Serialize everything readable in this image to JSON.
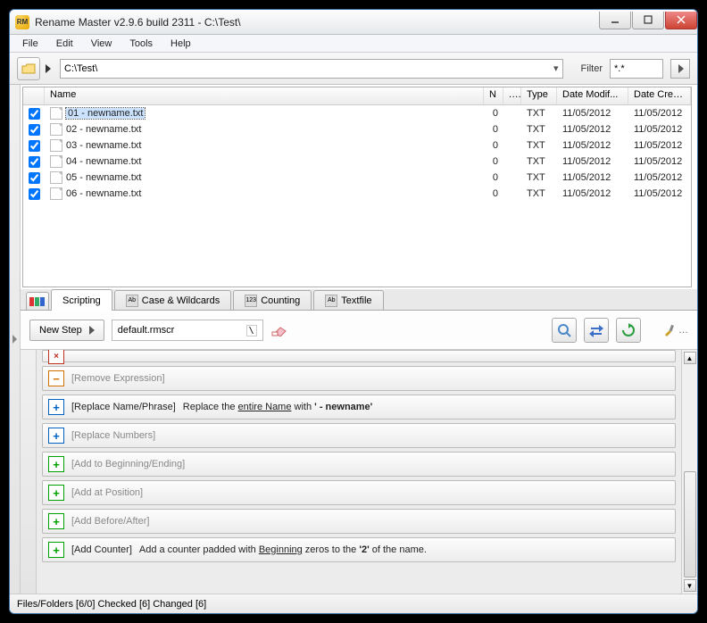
{
  "title": "Rename Master v2.9.6 build 2311 - C:\\Test\\",
  "menu": {
    "file": "File",
    "edit": "Edit",
    "view": "View",
    "tools": "Tools",
    "help": "Help"
  },
  "path": "C:\\Test\\",
  "filter_label": "Filter",
  "filter_value": "*.*",
  "columns": {
    "name": "Name",
    "n": "N",
    "dots": "...",
    "type": "Type",
    "date_modified": "Date Modif...",
    "date_created": "Date Crea..."
  },
  "files": [
    {
      "checked": true,
      "name": "01 - newname.txt",
      "n": "0",
      "type": "TXT",
      "dm": "11/05/2012",
      "dc": "11/05/2012",
      "selected": true
    },
    {
      "checked": true,
      "name": "02 - newname.txt",
      "n": "0",
      "type": "TXT",
      "dm": "11/05/2012",
      "dc": "11/05/2012",
      "selected": false
    },
    {
      "checked": true,
      "name": "03 - newname.txt",
      "n": "0",
      "type": "TXT",
      "dm": "11/05/2012",
      "dc": "11/05/2012",
      "selected": false
    },
    {
      "checked": true,
      "name": "04 - newname.txt",
      "n": "0",
      "type": "TXT",
      "dm": "11/05/2012",
      "dc": "11/05/2012",
      "selected": false
    },
    {
      "checked": true,
      "name": "05 - newname.txt",
      "n": "0",
      "type": "TXT",
      "dm": "11/05/2012",
      "dc": "11/05/2012",
      "selected": false
    },
    {
      "checked": true,
      "name": "06 - newname.txt",
      "n": "0",
      "type": "TXT",
      "dm": "11/05/2012",
      "dc": "11/05/2012",
      "selected": false
    }
  ],
  "tabs": {
    "scripting": "Scripting",
    "case": "Case & Wildcards",
    "counting": "Counting",
    "textfile": "Textfile"
  },
  "new_step": "New Step",
  "script_file": "default.rmscr",
  "steps": [
    {
      "btn": "close",
      "label": "",
      "enabled": false,
      "rich": null,
      "half": true
    },
    {
      "btn": "minus",
      "label": "[Remove Expression]",
      "enabled": false,
      "rich": null
    },
    {
      "btn": "plus-blue",
      "label": "[Replace Name/Phrase]",
      "enabled": true,
      "rich": {
        "prefix": "Replace the ",
        "underlined1": "entire Name",
        "mid": " with ",
        "bold": "' - newname'"
      }
    },
    {
      "btn": "plus-blue",
      "label": "[Replace Numbers]",
      "enabled": false,
      "rich": null
    },
    {
      "btn": "plus",
      "label": "[Add to Beginning/Ending]",
      "enabled": false,
      "rich": null
    },
    {
      "btn": "plus",
      "label": "[Add at Position]",
      "enabled": false,
      "rich": null
    },
    {
      "btn": "plus",
      "label": "[Add Before/After]",
      "enabled": false,
      "rich": null
    },
    {
      "btn": "plus",
      "label": "[Add Counter]",
      "enabled": true,
      "rich": {
        "prefix": "Add a counter padded with ",
        "bold": "'2'",
        "mid": " zeros to the ",
        "underlined1": "Beginning",
        "suffix": " of the name."
      }
    }
  ],
  "status": "Files/Folders [6/0] Checked [6] Changed [6]"
}
